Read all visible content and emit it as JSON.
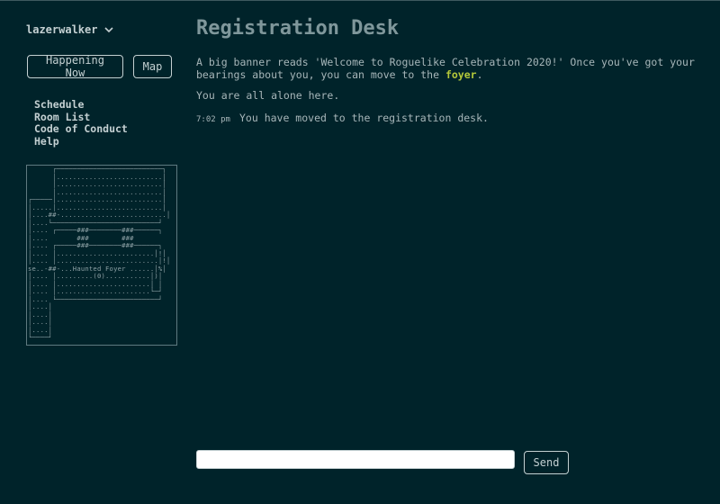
{
  "user": {
    "name": "lazerwalker",
    "menu_icon": "chevron-down-icon"
  },
  "buttons": {
    "happening_now": "Happening Now",
    "map": "Map"
  },
  "nav": {
    "schedule": "Schedule",
    "room_list": "Room List",
    "code_of_conduct": "Code of Conduct",
    "help": "Help"
  },
  "map_ascii": "      ┌──────────────────────────┐\n      │..........................│\n      │..........................│\n      │..........................│\n┌─────│..........................│\n│.....│..........................│\n│....##-..........................│\n│....└──────────────────────────┘\n│.... ┌─────###────────###──────┐\n│....       ###        ###\n│.... ┌─────###────────###──────┐\n│.... │........................│!│\n│.... │.........................│!│\nse..-##-...Haunted Foyer ......│%│\n│.... │.........(0)...........│)│\n│.... │.......................│ │\n│.... │.......................└─┘\n│.... └─────────────────────────┘\n│....│\n│....│\n│....│\n│....│\n└────┘",
  "room": {
    "title": "Registration Desk",
    "description_before": "A big banner reads 'Welcome to Roguelike Celebration 2020!' Once you've got your bearings about you, you can move to the ",
    "link": "foyer",
    "description_after": ".",
    "alone": "You are all alone here."
  },
  "messages": [
    {
      "time": "7:02 pm",
      "text": "You have moved to the registration desk."
    }
  ],
  "chat": {
    "placeholder": "",
    "send_label": "Send"
  },
  "colors": {
    "background": "#00232a",
    "title": "#7f979b",
    "link": "#b5c93a",
    "text": "#a7b6b9"
  }
}
